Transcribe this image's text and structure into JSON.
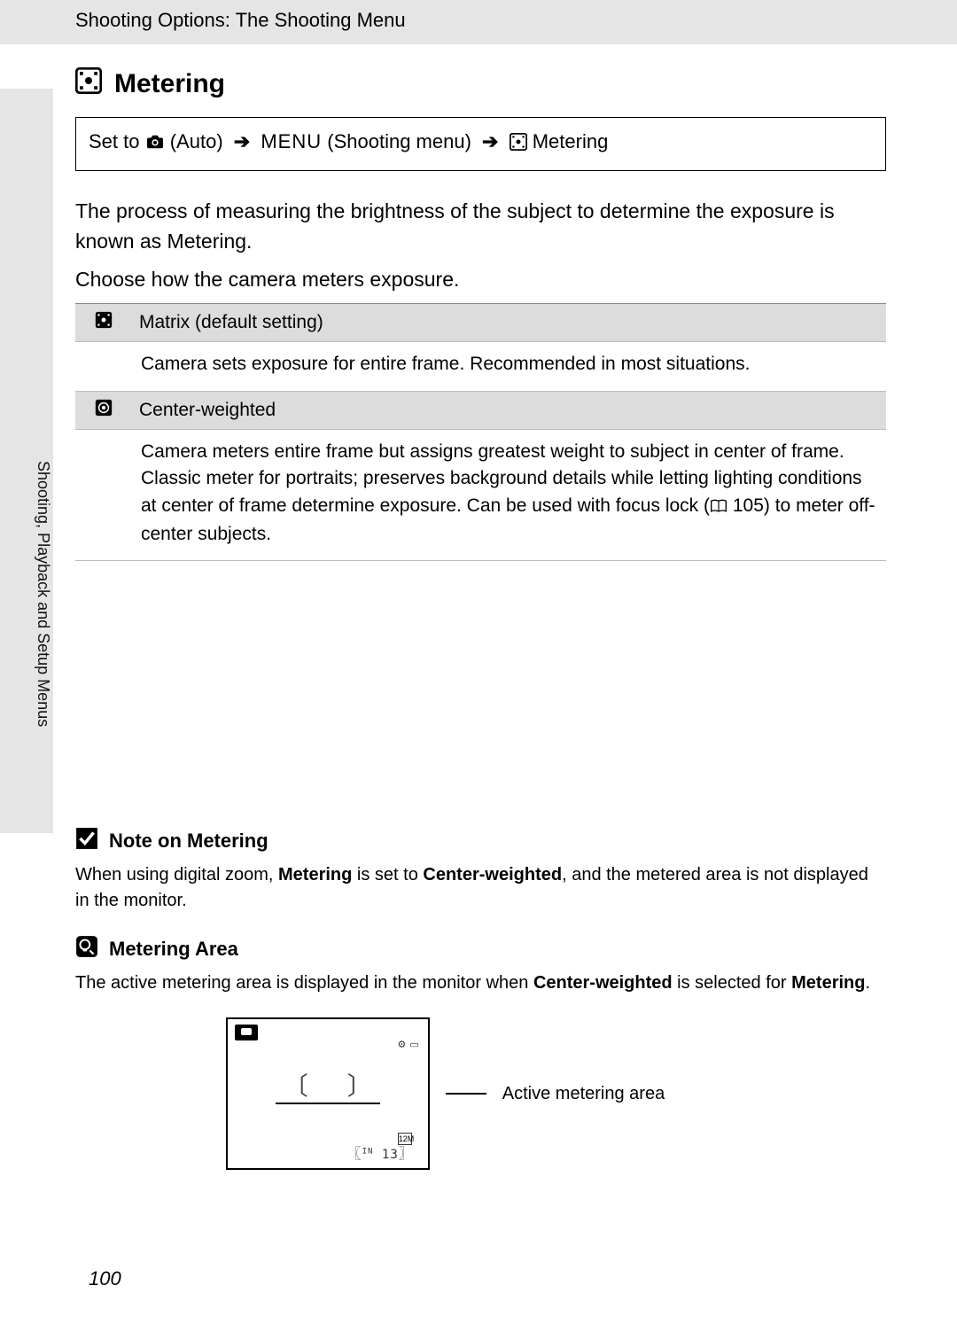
{
  "header": {
    "breadcrumb": "Shooting Options: The Shooting Menu"
  },
  "side_label": "Shooting, Playback and Setup Menus",
  "title": "Metering",
  "nav": {
    "prefix": "Set to",
    "auto": "(Auto)",
    "menu_word": "MENU",
    "menu_desc": "(Shooting menu)",
    "dest": "Metering"
  },
  "paragraphs": {
    "p1": "The process of measuring the brightness of the subject to determine the exposure is known as Metering.",
    "p2": "Choose how the camera meters exposure."
  },
  "options": [
    {
      "name": "Matrix (default setting)",
      "desc": "Camera sets exposure for entire frame. Recommended in most situations."
    },
    {
      "name": "Center-weighted",
      "desc_pre": "Camera meters entire frame but assigns greatest weight to subject in center of frame. Classic meter for portraits; preserves background details while letting lighting conditions at center of frame determine exposure. Can be used with focus lock (",
      "page_ref": "105",
      "desc_post": ") to meter off-center subjects."
    }
  ],
  "note": {
    "title": "Note on Metering",
    "text_pre": "When using digital zoom, ",
    "bold1": "Metering",
    "mid1": " is set to ",
    "bold2": "Center-weighted",
    "text_post": ", and the metered area is not displayed in the monitor."
  },
  "info": {
    "title": "Metering Area",
    "text_pre": "The active metering area is displayed in the monitor when ",
    "bold1": "Center-weighted",
    "mid1": " is selected for ",
    "bold2": "Metering",
    "text_post": "."
  },
  "monitor": {
    "size_label": "12M",
    "in_label": "IN",
    "count": "13",
    "callout": "Active metering area"
  },
  "page_number": "100"
}
